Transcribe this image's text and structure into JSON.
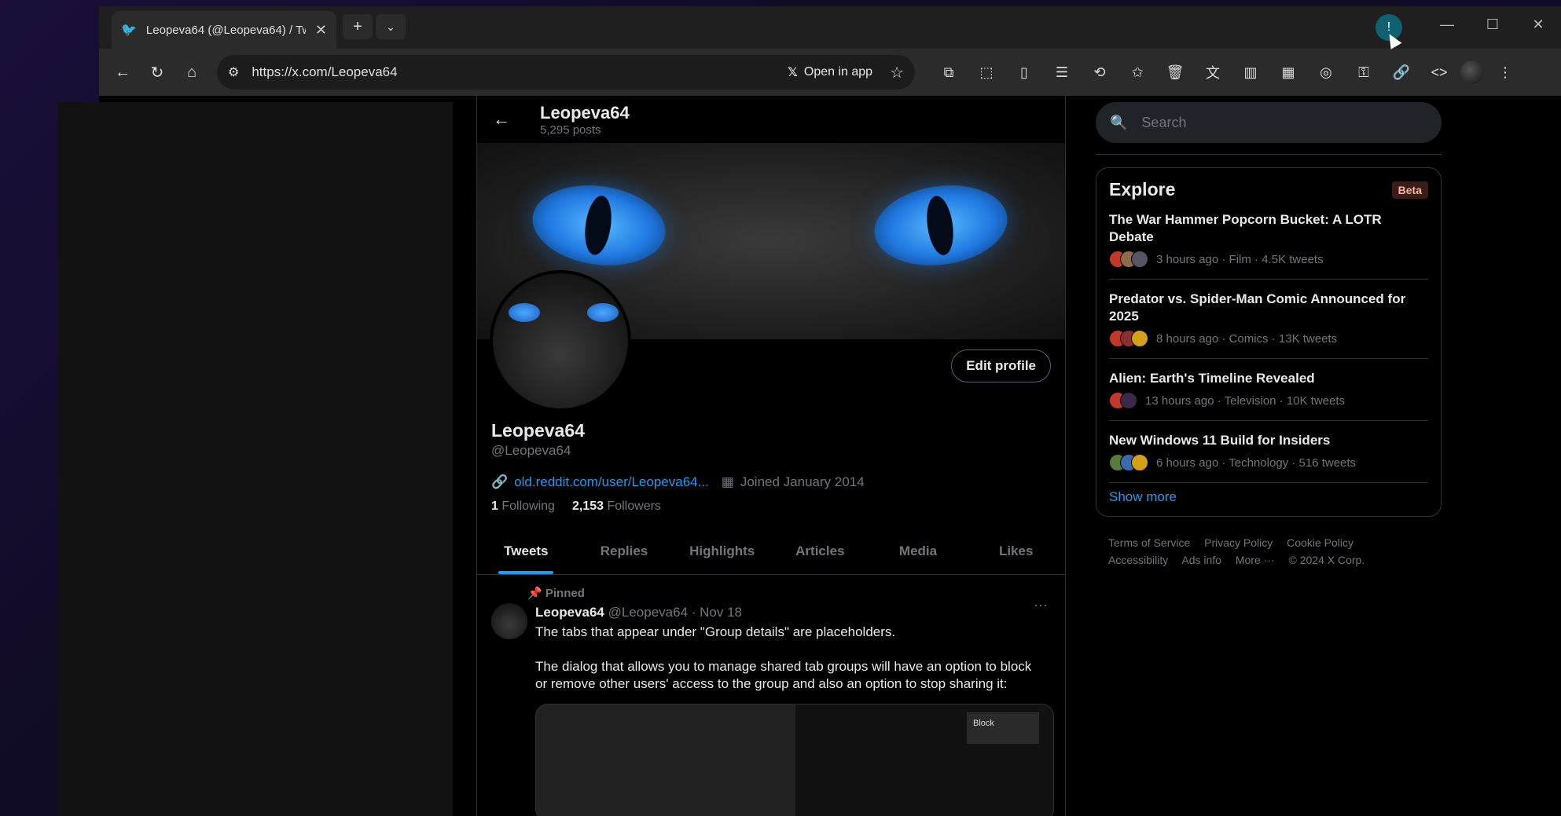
{
  "browser": {
    "tab_title": "Leopeva64 (@Leopeva64) / Twi",
    "url": "https://x.com/Leopeva64",
    "open_in_app": "Open in app"
  },
  "profile": {
    "header_name": "Leopeva64",
    "header_posts": "5,295 posts",
    "display_name": "Leopeva64",
    "handle": "@Leopeva64",
    "edit_profile": "Edit profile",
    "link": "old.reddit.com/user/Leopeva64...",
    "joined": "Joined January 2014",
    "following_count": "1",
    "following_label": "Following",
    "followers_count": "2,153",
    "followers_label": "Followers"
  },
  "tabs": [
    "Tweets",
    "Replies",
    "Highlights",
    "Articles",
    "Media",
    "Likes"
  ],
  "tweet": {
    "pinned": "Pinned",
    "author": "Leopeva64",
    "meta": "@Leopeva64 · Nov 18",
    "text1": "The tabs that appear under \"Group details\" are placeholders.",
    "text2": "The dialog that allows you to manage shared tab groups will have an option to block or remove other users' access to the group and also an option to stop sharing it:",
    "media_block": "Block"
  },
  "sidebar": {
    "search_placeholder": "Search",
    "explore_title": "Explore",
    "beta": "Beta",
    "stories": [
      {
        "title": "The War Hammer Popcorn Bucket: A LOTR Debate",
        "meta": "3 hours ago · Film · 4.5K tweets"
      },
      {
        "title": "Predator vs. Spider-Man Comic Announced for 2025",
        "meta": "8 hours ago · Comics · 13K tweets"
      },
      {
        "title": "Alien: Earth's Timeline Revealed",
        "meta": "13 hours ago · Television · 10K tweets"
      },
      {
        "title": "New Windows 11 Build for Insiders",
        "meta": "6 hours ago · Technology · 516 tweets"
      }
    ],
    "show_more": "Show more",
    "footer": [
      "Terms of Service",
      "Privacy Policy",
      "Cookie Policy",
      "Accessibility",
      "Ads info",
      "More ···",
      "© 2024 X Corp."
    ]
  },
  "colors": {
    "accent": "#1d9bf0",
    "bg": "#000000",
    "text": "#e7e9ea",
    "muted": "#71767b"
  }
}
